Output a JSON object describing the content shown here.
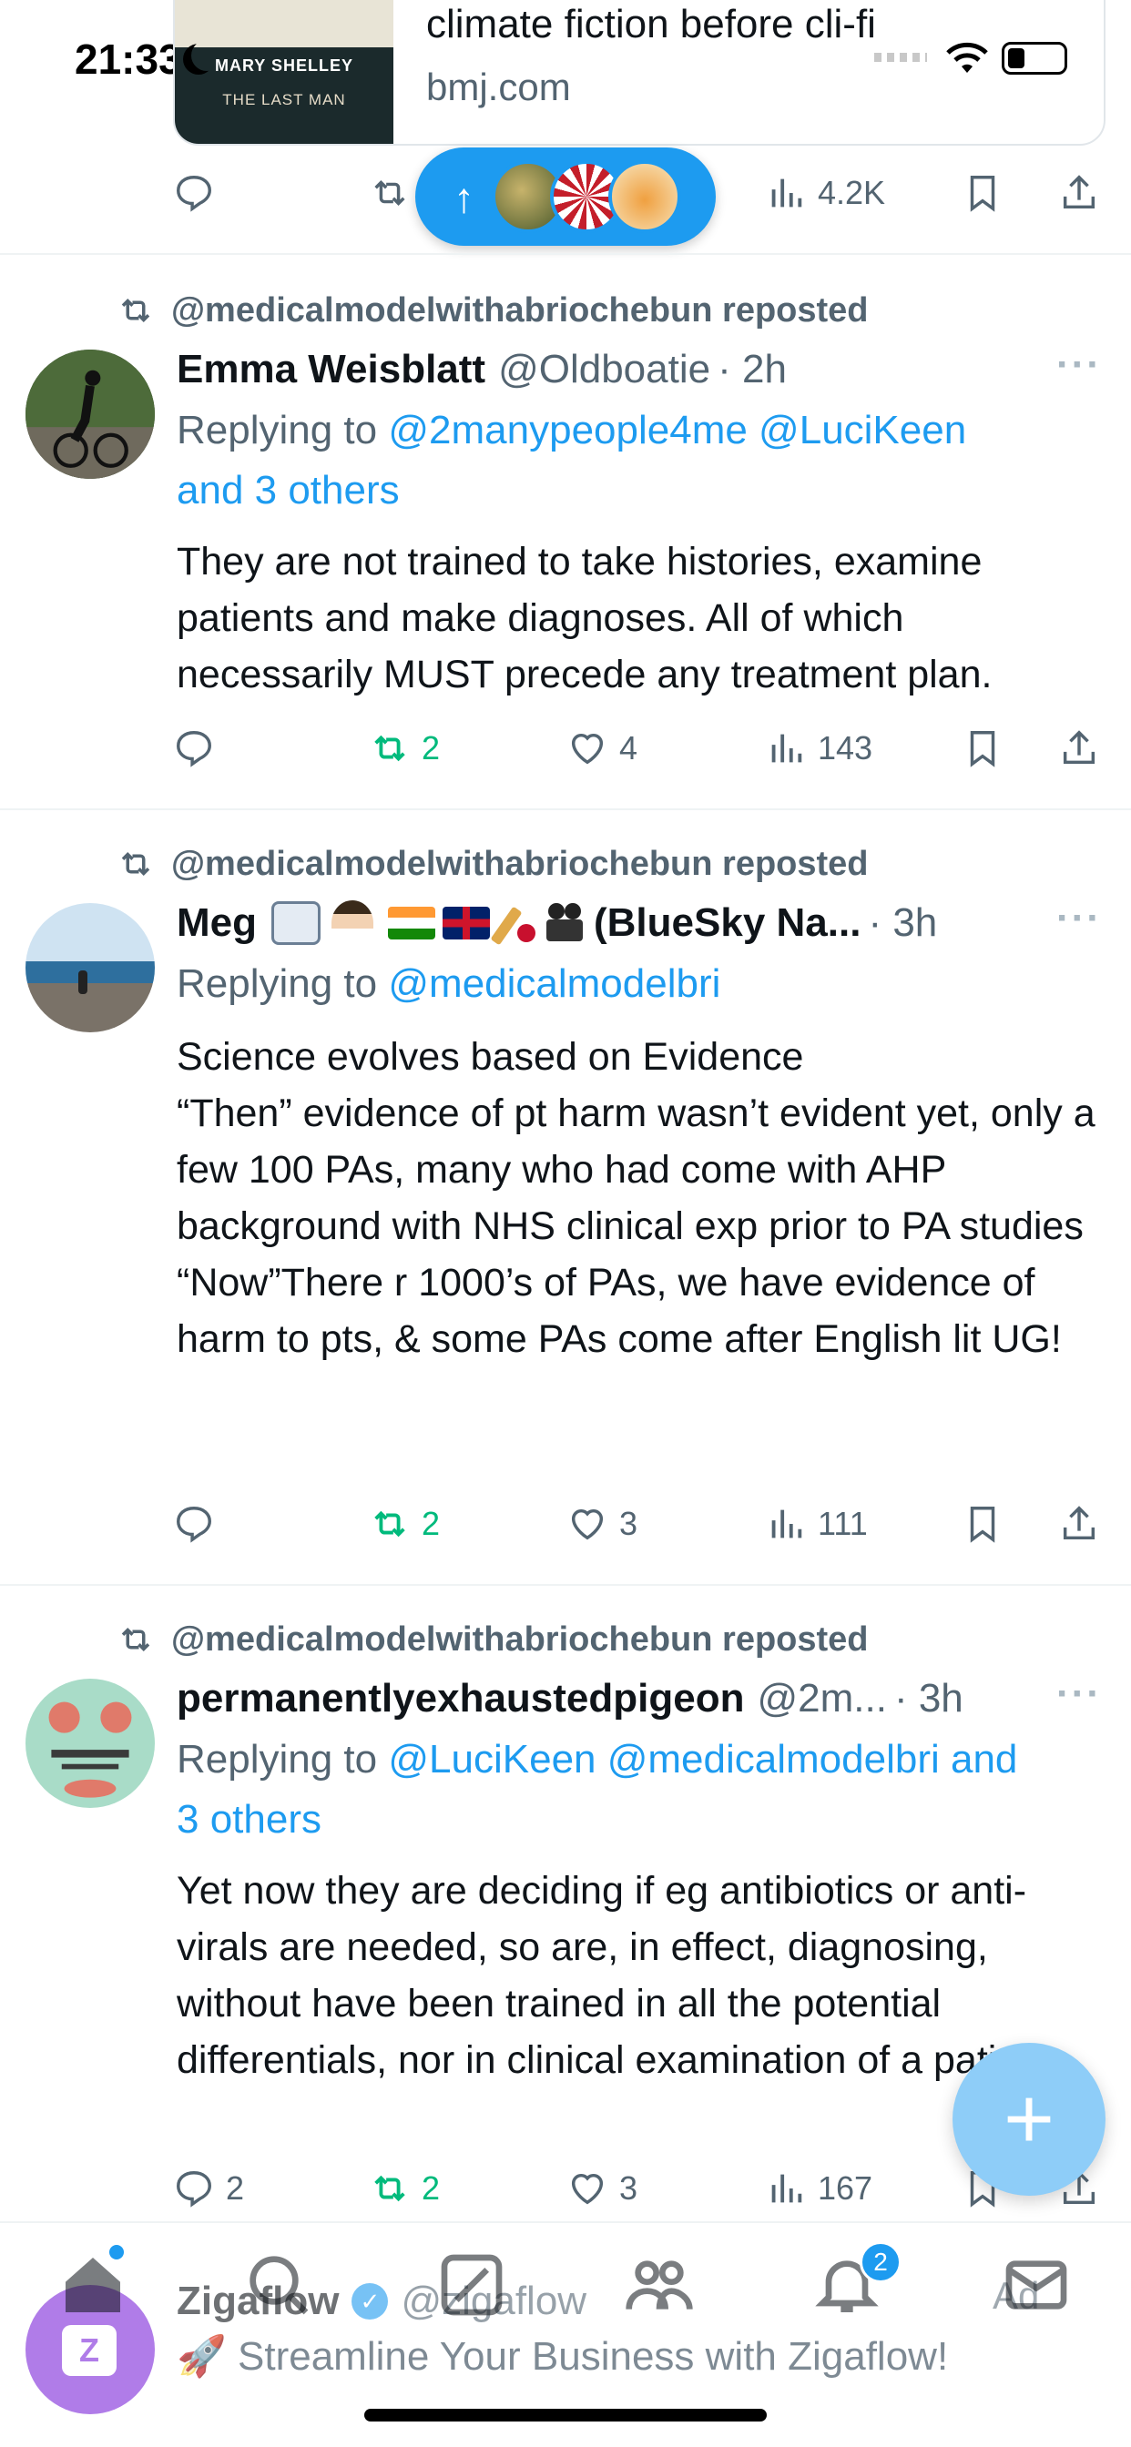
{
  "status_bar": {
    "time": "21:33"
  },
  "link_card": {
    "title": "climate fiction before cli-fi",
    "domain": "bmj.com",
    "thumbnail": {
      "author": "MARY SHELLEY",
      "book_title": "THE LAST MAN"
    }
  },
  "top_actions": {
    "views": "4.2K"
  },
  "new_posts_pill": {
    "arrow": "↑"
  },
  "tweets": [
    {
      "repost_label": "@medicalmodelwithabriochebun reposted",
      "name": "Emma Weisblatt",
      "handle": "@Oldboatie",
      "time": "· 2h",
      "reply_prefix": "Replying to",
      "reply_mentions_1": "@2manypeople4me @LuciKeen",
      "reply_mentions_2": "and 3 others",
      "body": "They are not trained to take histories, examine patients and make diagnoses. All of which necessarily MUST precede any treatment plan.",
      "reposts": "2",
      "likes": "4",
      "views": "143"
    },
    {
      "repost_label": "@medicalmodelwithabriochebun reposted",
      "name": "Meg",
      "name_rest": "(BlueSky Na...",
      "time": "· 3h",
      "reply_prefix": "Replying to",
      "reply_mentions_1": "@medicalmodelbri",
      "body_lines": [
        "Science evolves based on Evidence",
        "“Then” evidence of pt harm wasn’t evident yet, only a few 100 PAs, many who had come with AHP background with NHS clinical exp prior to PA studies",
        "“Now”There r 1000’s of PAs, we have evidence of harm to pts, & some PAs come after English lit UG!"
      ],
      "reposts": "2",
      "likes": "3",
      "views": "111"
    },
    {
      "repost_label": "@medicalmodelwithabriochebun reposted",
      "name": "permanentlyexhaustedpigeon",
      "handle": "@2m...",
      "time": "· 3h",
      "reply_prefix": "Replying to",
      "reply_mentions_1": "@LuciKeen @medicalmodelbri and",
      "reply_mentions_2": "3 others",
      "body": "Yet now they are deciding if eg antibiotics or anti-virals are needed, so are, in effect, diagnosing, without have been trained in all the potential differentials, nor in clinical examination of a patient",
      "replies": "2",
      "reposts": "2",
      "likes": "3",
      "views": "167"
    }
  ],
  "ad": {
    "name": "Zigaflow",
    "handle": "@zigaflow",
    "label": "Ad",
    "text": "🚀 Streamline Your Business with Zigaflow!",
    "avatar_letter": "Z"
  },
  "fab": {
    "icon": "+"
  },
  "nav": {
    "notifications_badge": "2"
  },
  "colors": {
    "accent": "#1d9bf0",
    "repost_green": "#00ba7c",
    "muted": "#536471"
  },
  "icons": [
    "reply-icon",
    "repost-icon",
    "like-icon",
    "views-icon",
    "bookmark-icon",
    "share-icon",
    "more-icon",
    "home-icon",
    "search-icon",
    "grok-icon",
    "communities-icon",
    "bell-icon",
    "mail-icon"
  ]
}
